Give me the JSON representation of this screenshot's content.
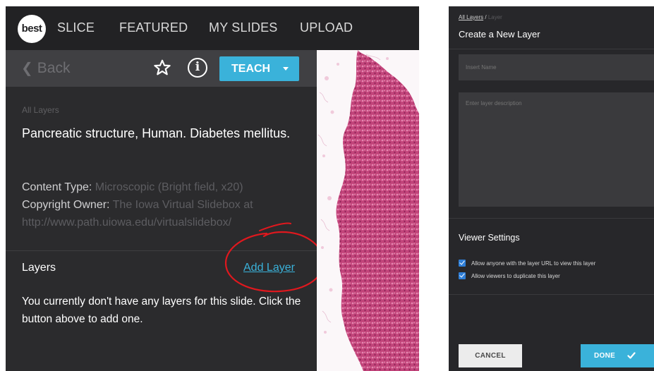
{
  "nav": {
    "logo": "best",
    "items": [
      "SLICE",
      "FEATURED",
      "MY SLIDES",
      "UPLOAD"
    ]
  },
  "toolbar": {
    "back_label": "Back",
    "teach_label": "TEACH"
  },
  "slide": {
    "breadcrumb": "All Layers",
    "title": "Pancreatic structure, Human. Diabetes mellitus.",
    "content_type_label": "Content Type:",
    "content_type_value": "Microscopic (Bright field, x20)",
    "copyright_label": "Copyright Owner:",
    "copyright_value": "The Iowa Virtual Slidebox at",
    "copyright_url": "http://www.path.uiowa.edu/virtualslidebox/"
  },
  "layers": {
    "label": "Layers",
    "add_label": "Add Layer",
    "empty_message": "You currently don't have any layers for this slide. Click the button above to add one."
  },
  "modal": {
    "breadcrumb_link": "All Layers",
    "breadcrumb_sep": "/",
    "breadcrumb_current": "Layer",
    "title": "Create a New Layer",
    "name_placeholder": "Insert Name",
    "description_placeholder": "Enter layer description",
    "viewer_settings_label": "Viewer Settings",
    "options": [
      {
        "label": "Allow anyone with the layer URL to view this layer",
        "checked": true
      },
      {
        "label": "Allow viewers to duplicate this layer",
        "checked": true
      }
    ],
    "cancel_label": "CANCEL",
    "done_label": "DONE"
  },
  "colors": {
    "accent": "#3ab2da",
    "annotation": "#e0181e",
    "tissue": "#c2447a"
  }
}
